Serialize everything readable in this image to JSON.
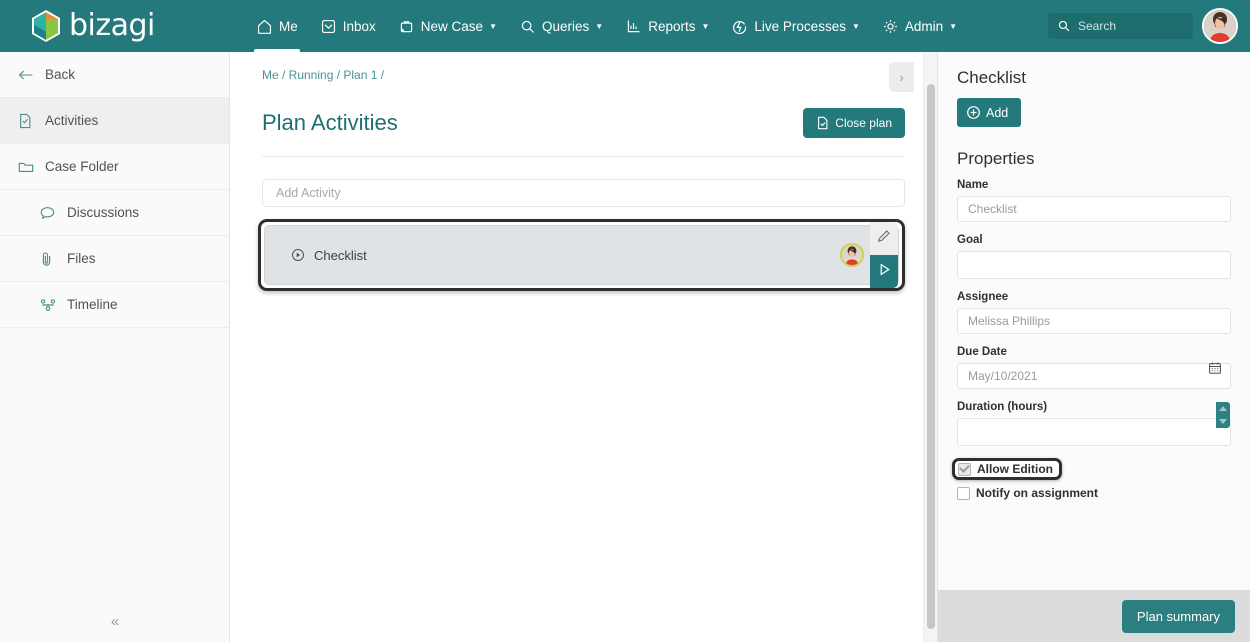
{
  "brand": {
    "name": "bizagi",
    "teal": "#23797b",
    "accent_orange": "#f0883c",
    "accent_green": "#8cc63f"
  },
  "topnav": {
    "items": [
      {
        "label": "Me",
        "icon": "home-icon",
        "has_caret": false,
        "active": true
      },
      {
        "label": "Inbox",
        "icon": "inbox-icon",
        "has_caret": false,
        "active": false
      },
      {
        "label": "New Case",
        "icon": "briefcase-plus-icon",
        "has_caret": true,
        "active": false
      },
      {
        "label": "Queries",
        "icon": "magnifier-icon",
        "has_caret": true,
        "active": false
      },
      {
        "label": "Reports",
        "icon": "chart-icon",
        "has_caret": true,
        "active": false
      },
      {
        "label": "Live Processes",
        "icon": "bolt-circle-icon",
        "has_caret": true,
        "active": false
      },
      {
        "label": "Admin",
        "icon": "gear-icon",
        "has_caret": true,
        "active": false
      }
    ],
    "search": {
      "placeholder": "Search",
      "icon": "search-icon"
    },
    "avatar": "user-avatar"
  },
  "sidebar": {
    "items": [
      {
        "label": "Back",
        "icon": "arrow-left-icon",
        "active": false,
        "sub": false
      },
      {
        "label": "Activities",
        "icon": "document-check-icon",
        "active": true,
        "sub": false
      },
      {
        "label": "Case Folder",
        "icon": "folder-icon",
        "active": false,
        "sub": false
      },
      {
        "label": "Discussions",
        "icon": "chat-bubble-icon",
        "active": false,
        "sub": true
      },
      {
        "label": "Files",
        "icon": "paperclip-icon",
        "active": false,
        "sub": true
      },
      {
        "label": "Timeline",
        "icon": "timeline-icon",
        "active": false,
        "sub": true
      }
    ],
    "collapse_icon": "double-chevron-left-icon"
  },
  "main": {
    "breadcrumb": "Me / Running / Plan 1 /",
    "title": "Plan Activities",
    "close_plan_button": {
      "label": "Close plan",
      "icon": "file-check-icon"
    },
    "add_activity_placeholder": "Add Activity",
    "activities": [
      {
        "name": "Checklist",
        "icon": "play-circle-icon",
        "assignee_avatar": "assignee-avatar",
        "edit_icon": "pencil-icon",
        "run_icon": "play-triangle-icon",
        "selected": true
      }
    ],
    "panel_toggle_icon": "chevron-right-icon"
  },
  "right_panel": {
    "heading": "Checklist",
    "add_button": {
      "label": "Add",
      "icon": "plus-circle-icon"
    },
    "properties_heading": "Properties",
    "fields": [
      {
        "label": "Name",
        "value": "Checklist",
        "type": "text"
      },
      {
        "label": "Goal",
        "value": "",
        "type": "text"
      },
      {
        "label": "Assignee",
        "value": "Melissa Phillips",
        "type": "text"
      },
      {
        "label": "Due Date",
        "value": "May/10/2021",
        "type": "date",
        "icon": "calendar-icon"
      },
      {
        "label": "Duration (hours)",
        "value": "",
        "type": "number",
        "icon": "spinner-icon"
      }
    ],
    "checkboxes": [
      {
        "label": "Allow Edition",
        "checked": true,
        "highlighted": true
      },
      {
        "label": "Notify on assignment",
        "checked": false,
        "highlighted": false
      }
    ],
    "footer_button": {
      "label": "Plan summary"
    }
  }
}
